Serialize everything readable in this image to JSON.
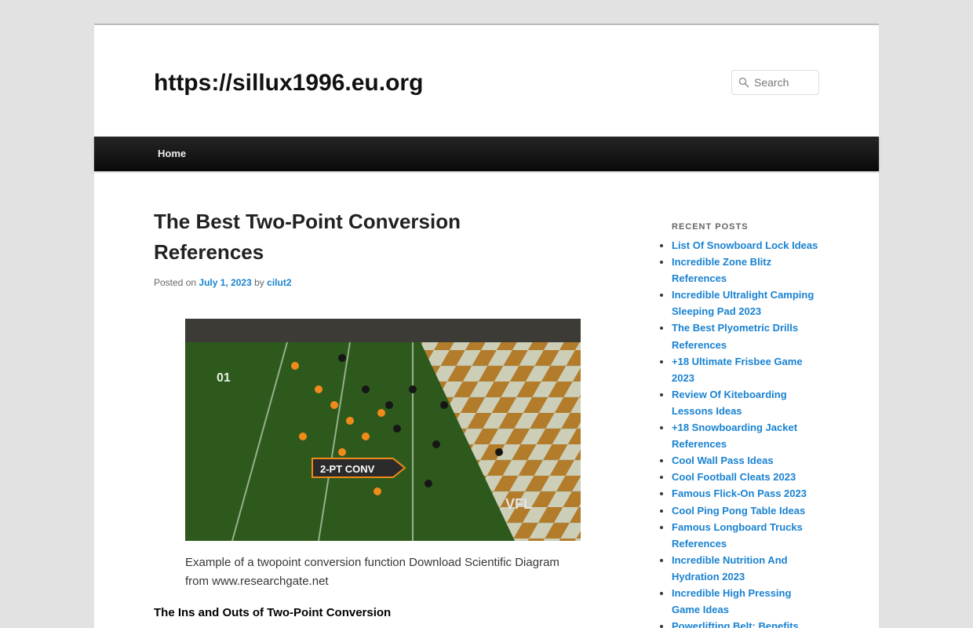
{
  "header": {
    "site_title": "https://sillux1996.eu.org",
    "search_placeholder": "Search",
    "search_icon": "search-icon"
  },
  "nav": {
    "home_label": "Home"
  },
  "post": {
    "title": "The Best Two-Point Conversion References",
    "posted_on_label": "Posted on",
    "date": "July 1, 2023",
    "by_label": "by",
    "author": "cilut2",
    "image_overlay_text": "2-PT CONV",
    "image_logo_text": "VFL",
    "image_yard_text": "01",
    "caption": "Example of a twopoint conversion function Download Scientific Diagram from www.researchgate.net",
    "section_heading": "The Ins and Outs of Two-Point Conversion"
  },
  "sidebar": {
    "widget_title": "Recent Posts",
    "items": [
      "List Of Snowboard Lock Ideas",
      "Incredible Zone Blitz References",
      "Incredible Ultralight Camping Sleeping Pad 2023",
      "The Best Plyometric Drills References",
      "+18 Ultimate Frisbee Game 2023",
      "Review Of Kiteboarding Lessons Ideas",
      "+18 Snowboarding Jacket References",
      "Cool Wall Pass Ideas",
      "Cool Football Cleats 2023",
      "Famous Flick-On Pass 2023",
      "Cool Ping Pong Table Ideas",
      "Famous Longboard Trucks References",
      "Incredible Nutrition And Hydration 2023",
      "Incredible High Pressing Game Ideas",
      "Powerlifting Belt: Benefits,"
    ]
  },
  "colors": {
    "link": "#1982d1",
    "nav_bg": "#111111",
    "page_bg": "#e2e2e2"
  }
}
